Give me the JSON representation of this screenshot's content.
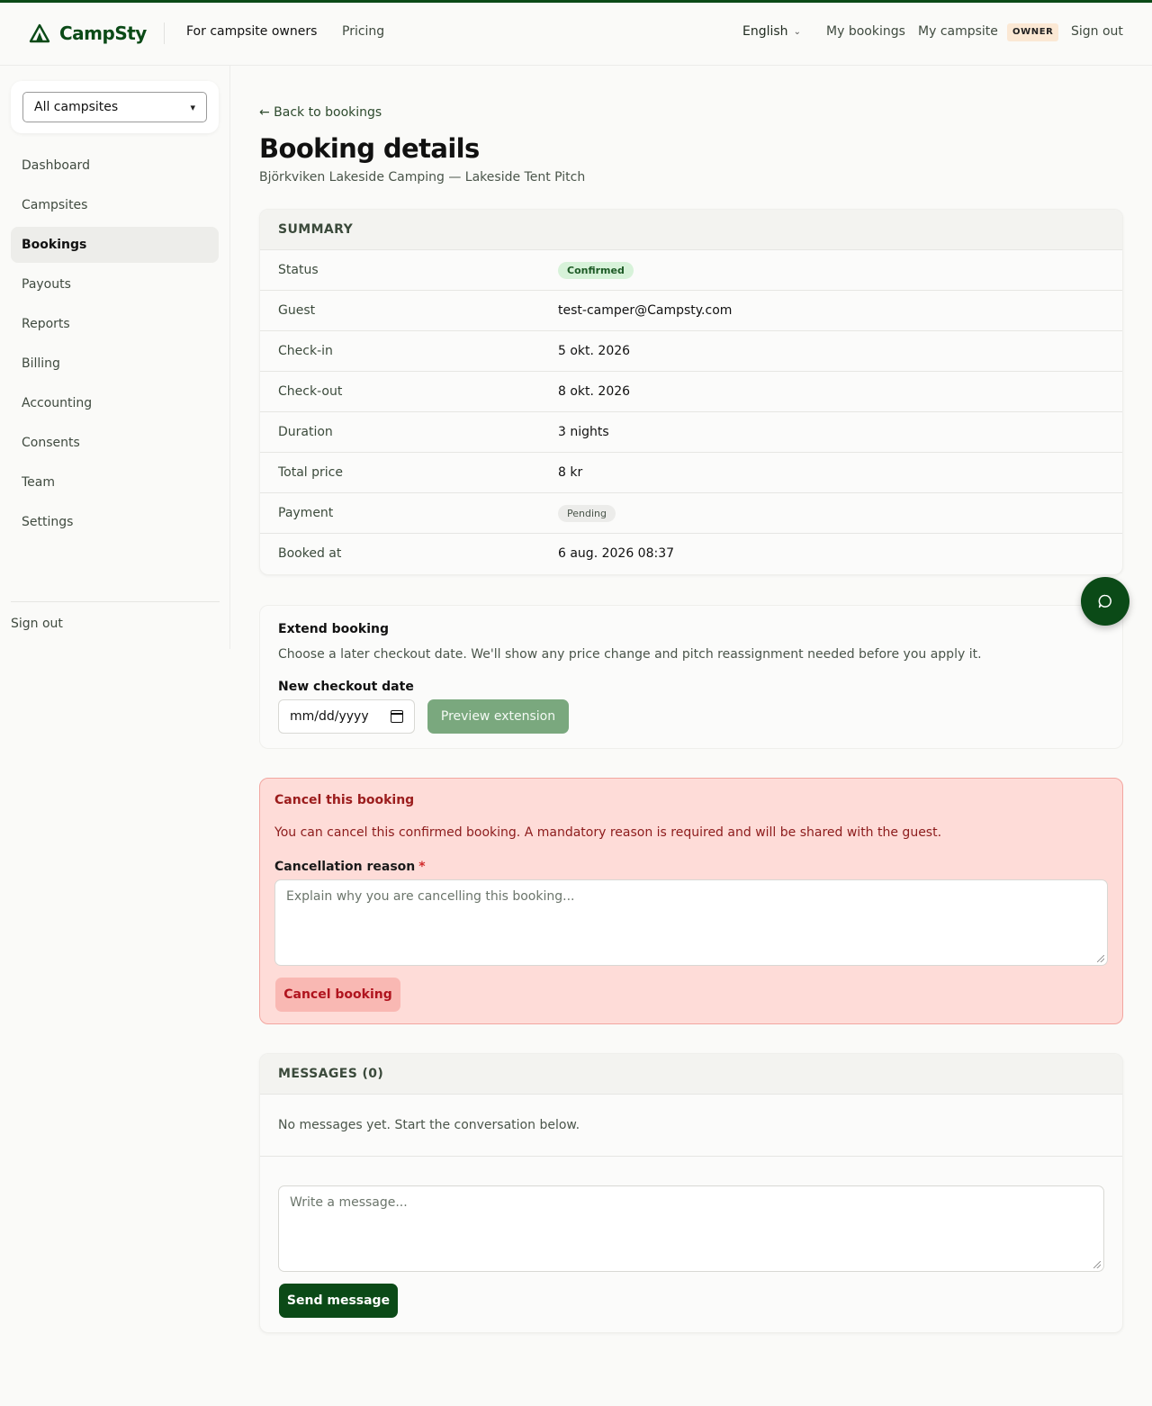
{
  "brand": {
    "name": "CampSty",
    "accent": "#0b4a17"
  },
  "header": {
    "nav_owners": "For campsite owners",
    "nav_pricing": "Pricing",
    "language": "English",
    "my_bookings": "My bookings",
    "my_campsite": "My campsite",
    "role_badge": "OWNER",
    "sign_out": "Sign out"
  },
  "sidebar": {
    "campsite_select": "All campsites",
    "items": [
      {
        "label": "Dashboard",
        "active": false
      },
      {
        "label": "Campsites",
        "active": false
      },
      {
        "label": "Bookings",
        "active": true
      },
      {
        "label": "Payouts",
        "active": false
      },
      {
        "label": "Reports",
        "active": false
      },
      {
        "label": "Billing",
        "active": false
      },
      {
        "label": "Accounting",
        "active": false
      },
      {
        "label": "Consents",
        "active": false
      },
      {
        "label": "Team",
        "active": false
      },
      {
        "label": "Settings",
        "active": false
      }
    ],
    "sign_out": "Sign out"
  },
  "main": {
    "back_link": "← Back to bookings",
    "title": "Booking details",
    "subtitle": "Björkviken Lakeside Camping — Lakeside Tent Pitch"
  },
  "summary": {
    "heading": "SUMMARY",
    "rows": {
      "status": {
        "label": "Status",
        "value": "Confirmed"
      },
      "guest": {
        "label": "Guest",
        "value": "test-camper@Campsty.com"
      },
      "checkin": {
        "label": "Check-in",
        "value": "5 okt. 2026"
      },
      "checkout": {
        "label": "Check-out",
        "value": "8 okt. 2026"
      },
      "duration": {
        "label": "Duration",
        "value": "3 nights"
      },
      "total": {
        "label": "Total price",
        "value": "8 kr"
      },
      "payment": {
        "label": "Payment",
        "value": "Pending"
      },
      "booked": {
        "label": "Booked at",
        "value": "6 aug. 2026 08:37"
      }
    }
  },
  "extend": {
    "title": "Extend booking",
    "description": "Choose a later checkout date. We'll show any price change and pitch reassignment needed before you apply it.",
    "date_label": "New checkout date",
    "date_placeholder": "mm/dd/yyyy",
    "preview_button": "Preview extension"
  },
  "cancel": {
    "title": "Cancel this booking",
    "description": "You can cancel this confirmed booking. A mandatory reason is required and will be shared with the guest.",
    "reason_label": "Cancellation reason",
    "required_mark": "*",
    "reason_placeholder": "Explain why you are cancelling this booking...",
    "button": "Cancel booking"
  },
  "messages": {
    "heading": "MESSAGES (0)",
    "empty_text": "No messages yet. Start the conversation below.",
    "input_placeholder": "Write a message...",
    "send_button": "Send message"
  },
  "icons": {
    "logo": "tent-icon",
    "language_chevron": "chevron-down-icon",
    "calendar": "calendar-icon",
    "chat": "chat-bubble-icon"
  }
}
